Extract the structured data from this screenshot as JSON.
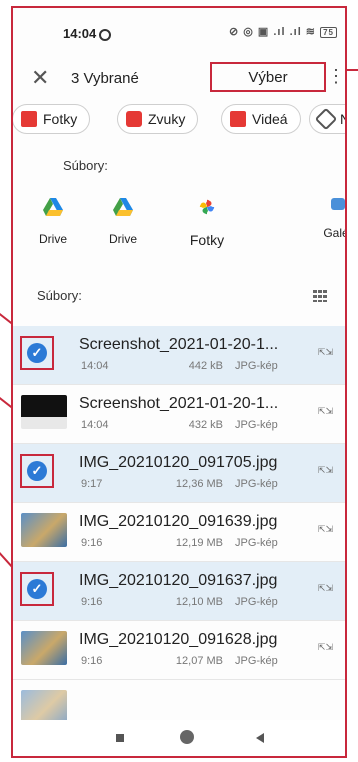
{
  "status": {
    "time": "14:04",
    "icons": "⊘ ◎ ▣ .ıl .ıl ≋",
    "battery": "75"
  },
  "topbar": {
    "close_icon": "close-icon",
    "title": "3 Vybrané",
    "action_label": "Výber",
    "menu_icon": "kebab-menu-icon"
  },
  "chips": [
    {
      "label": "Fotky",
      "color": "#e53935"
    },
    {
      "label": "Zvuky",
      "color": "#e53935"
    },
    {
      "label": "Videá",
      "color": "#e53935"
    },
    {
      "label": "N",
      "color": "#555555"
    }
  ],
  "sources_label": "Súbory:",
  "apps": [
    {
      "label": "Drive"
    },
    {
      "label": "Drive"
    },
    {
      "label": "Fotky"
    },
    {
      "label": "Galér"
    }
  ],
  "files_label": "Súbory:",
  "files": [
    {
      "name": "Screenshot_2021-01-20-1...",
      "time": "14:04",
      "size": "442 kB",
      "type": "JPG-kép",
      "selected": true
    },
    {
      "name": "Screenshot_2021-01-20-1...",
      "time": "14:04",
      "size": "432 kB",
      "type": "JPG-kép",
      "selected": false
    },
    {
      "name": "IMG_20210120_091705.jpg",
      "time": "9:17",
      "size": "12,36 MB",
      "type": "JPG-kép",
      "selected": true
    },
    {
      "name": "IMG_20210120_091639.jpg",
      "time": "9:16",
      "size": "12,19 MB",
      "type": "JPG-kép",
      "selected": false
    },
    {
      "name": "IMG_20210120_091637.jpg",
      "time": "9:16",
      "size": "12,10 MB",
      "type": "JPG-kép",
      "selected": true
    },
    {
      "name": "IMG_20210120_091628.jpg",
      "time": "9:16",
      "size": "12,07 MB",
      "type": "JPG-kép",
      "selected": false
    }
  ],
  "colors": {
    "accent": "#c8283c",
    "selected_row": "#e3eef7",
    "check": "#2c7ad6"
  }
}
